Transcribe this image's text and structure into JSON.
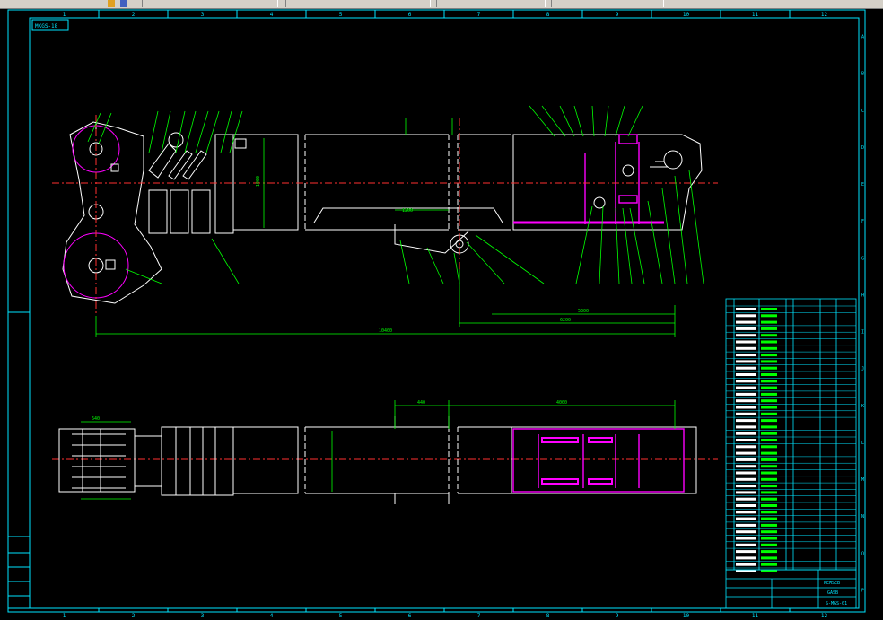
{
  "drawing": {
    "title_tag": "MKGS-18",
    "colors": {
      "frame": "#00e5ff",
      "part": "#ffffff",
      "dim": "#00ff00",
      "center": "#ff3030",
      "hl": "#ff00ff",
      "bg": "#000000"
    },
    "col_labels": [
      "1",
      "2",
      "3",
      "4",
      "5",
      "6",
      "7",
      "8",
      "9",
      "10",
      "11",
      "12"
    ],
    "row_labels": [
      "A",
      "B",
      "C",
      "D",
      "E",
      "F",
      "G",
      "H",
      "I",
      "J",
      "K",
      "L",
      "M",
      "N",
      "O",
      "P"
    ],
    "dims": {
      "overall": "10400",
      "right_span": "6200",
      "right_short": "5300",
      "height": "1900",
      "top_seg_a": "440",
      "top_seg_b": "4000",
      "mid_a": "640",
      "mid_b": "1200"
    },
    "title_block": {
      "name": "NEMSEB",
      "sub": "GASB",
      "code": "S-MGS-01"
    }
  }
}
